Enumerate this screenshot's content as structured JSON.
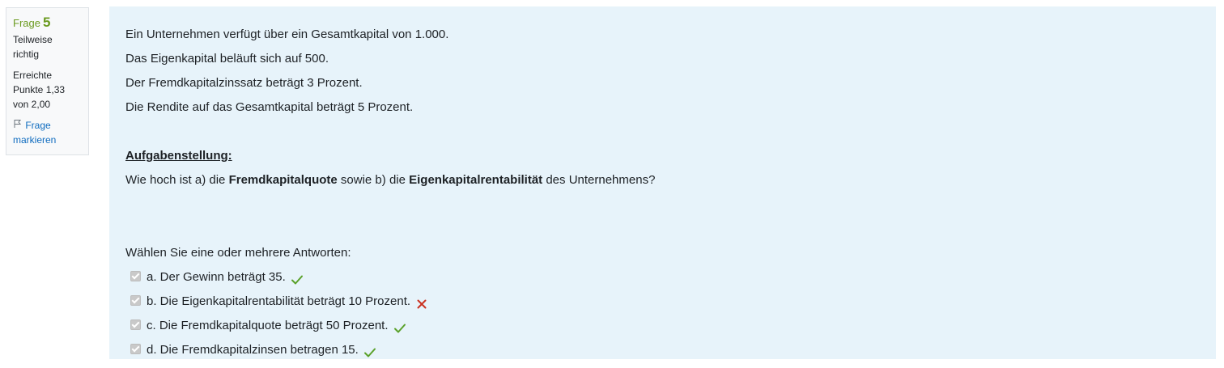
{
  "info": {
    "question_label": "Frage",
    "question_number": "5",
    "state_line1": "Teilweise",
    "state_line2": "richtig",
    "grade_line1": "Erreichte",
    "grade_line2": "Punkte 1,33",
    "grade_line3": "von 2,00",
    "flag_line1": "Frage",
    "flag_line2": "markieren"
  },
  "question": {
    "lines": [
      "Ein Unternehmen verfügt über ein Gesamtkapital von 1.000.",
      "Das Eigenkapital beläuft sich auf 500.",
      "Der Fremdkapitalzinssatz beträgt 3 Prozent.",
      "Die Rendite auf das Gesamtkapital beträgt 5 Prozent."
    ],
    "task_heading": "Aufgabenstellung:",
    "task_part1": "Wie hoch ist a) die ",
    "task_bold1": "Fremdkapitalquote",
    "task_part2": " sowie b) die ",
    "task_bold2": "Eigenkapitalrentabilität",
    "task_part3": " des Unternehmens?",
    "prompt": "Wählen Sie eine oder mehrere Antworten:"
  },
  "answers": [
    {
      "label": "a. Der Gewinn beträgt 35.",
      "checked": true,
      "result": "correct"
    },
    {
      "label": "b. Die Eigenkapitalrentabilität beträgt 10 Prozent.",
      "checked": true,
      "result": "incorrect"
    },
    {
      "label": "c. Die Fremdkapitalquote beträgt 50 Prozent.",
      "checked": true,
      "result": "correct"
    },
    {
      "label": "d. Die Fremdkapitalzinsen betragen 15.",
      "checked": true,
      "result": "correct"
    }
  ],
  "colors": {
    "correct": "#5aa12a",
    "incorrect": "#ca3120",
    "question_number": "#6a9a1f",
    "link": "#0f6cbf",
    "content_background": "#e7f3fa"
  }
}
